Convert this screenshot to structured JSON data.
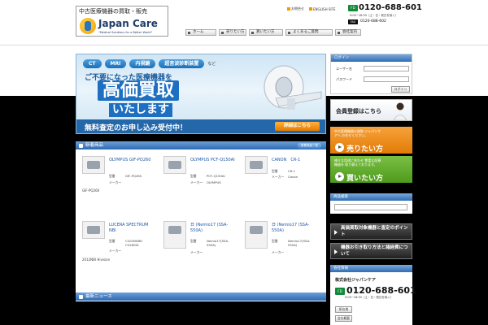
{
  "header": {
    "logo_tagline": "中古医療機器の買取・販売",
    "logo_name": "Japan Care",
    "logo_sub": "\"Medical Solutions for a Better World\"",
    "contact_link": "お問合せ",
    "english_link": "ENGLISH SITE",
    "free_dial_badge": "FD",
    "tel": "0120-688-601",
    "hours": "9:00~18:30（土・日・祝日を除く）",
    "fax_badge": "FAX",
    "fax": "0120-688-602"
  },
  "nav": {
    "home": "ホーム",
    "sell": "売りたい方",
    "buy": "買いたい方",
    "faq": "よくあるご質問",
    "company": "会社案内"
  },
  "hero": {
    "tags": [
      "CT",
      "MRI",
      "内視鏡",
      "超音波診断装置"
    ],
    "tag_etc": "など",
    "line1": "ご不要になった医療機器を",
    "big": "高価買取",
    "mid": "いたします",
    "bar": "無料査定のお申し込み受付中！",
    "detail_button": "詳細はこちら"
  },
  "new_products": {
    "title": "新着商品",
    "more": "新着商品一覧",
    "items": [
      {
        "name": "OLYMPUS GIF-PQ260",
        "model_label": "型番",
        "model": "GIF-PQ260",
        "maker_label": "メーカー",
        "maker": "",
        "foot": "GIF-PQ260"
      },
      {
        "name": "OLYMPUS PCF-Q150AI",
        "model_label": "型番",
        "model": "PCF-Q150AI",
        "maker_label": "メーカー",
        "maker": "OLYMPUS",
        "foot": ""
      },
      {
        "name": "CANON　CR-1",
        "model_label": "型番",
        "model": "CR-1",
        "maker_label": "メーカー",
        "maker": "Canon",
        "foot": ""
      },
      {
        "name": "LUCERA SPECTRUM NBI",
        "model_label": "型番",
        "model": "CLV260NBI CV260SL",
        "maker_label": "メーカー",
        "maker": "",
        "foot": "2012NBI Hivision"
      },
      {
        "name": "日 (Nemio17 (SSA-550A)",
        "model_label": "型番",
        "model": "Nemio17(SSA-550A)",
        "maker_label": "メーカー",
        "maker": "",
        "foot": ""
      },
      {
        "name": "日 (Nemio17 (SSA-550A)",
        "model_label": "型番",
        "model": "Nemio17(SSA-550A)",
        "maker_label": "メーカー",
        "maker": "",
        "foot": ""
      }
    ]
  },
  "news": {
    "title": "最新ニュース"
  },
  "sidebar": {
    "login_title": "ログイン",
    "username_label": "ユーザー名",
    "password_label": "パスワード",
    "login_button": "ログイン",
    "member_banner": "会員登録はこちら",
    "sell_banner_small": "中古医療機器の買取 ジャパンケアへ お任せください。",
    "sell_banner_big": "売りたい方",
    "buy_banner_small": "様々な用途に合わせ 豊富な医療機器を 取り揃えております。",
    "buy_banner_big": "買いたい方",
    "search_title": "商品検索",
    "points_button": "高価買取対象機器と査定のポイント",
    "flow_button": "機器お引き取り方法と諸経費について",
    "company_title": "会社情報",
    "company_name": "株式会社ジャパンケア",
    "company_tel": "0120-688-601",
    "company_hours": "9:00~18:30（土・日・祝日を除く）",
    "company_badge": "FD",
    "company_btn1": "所在地",
    "company_btn2": "会社概要"
  }
}
